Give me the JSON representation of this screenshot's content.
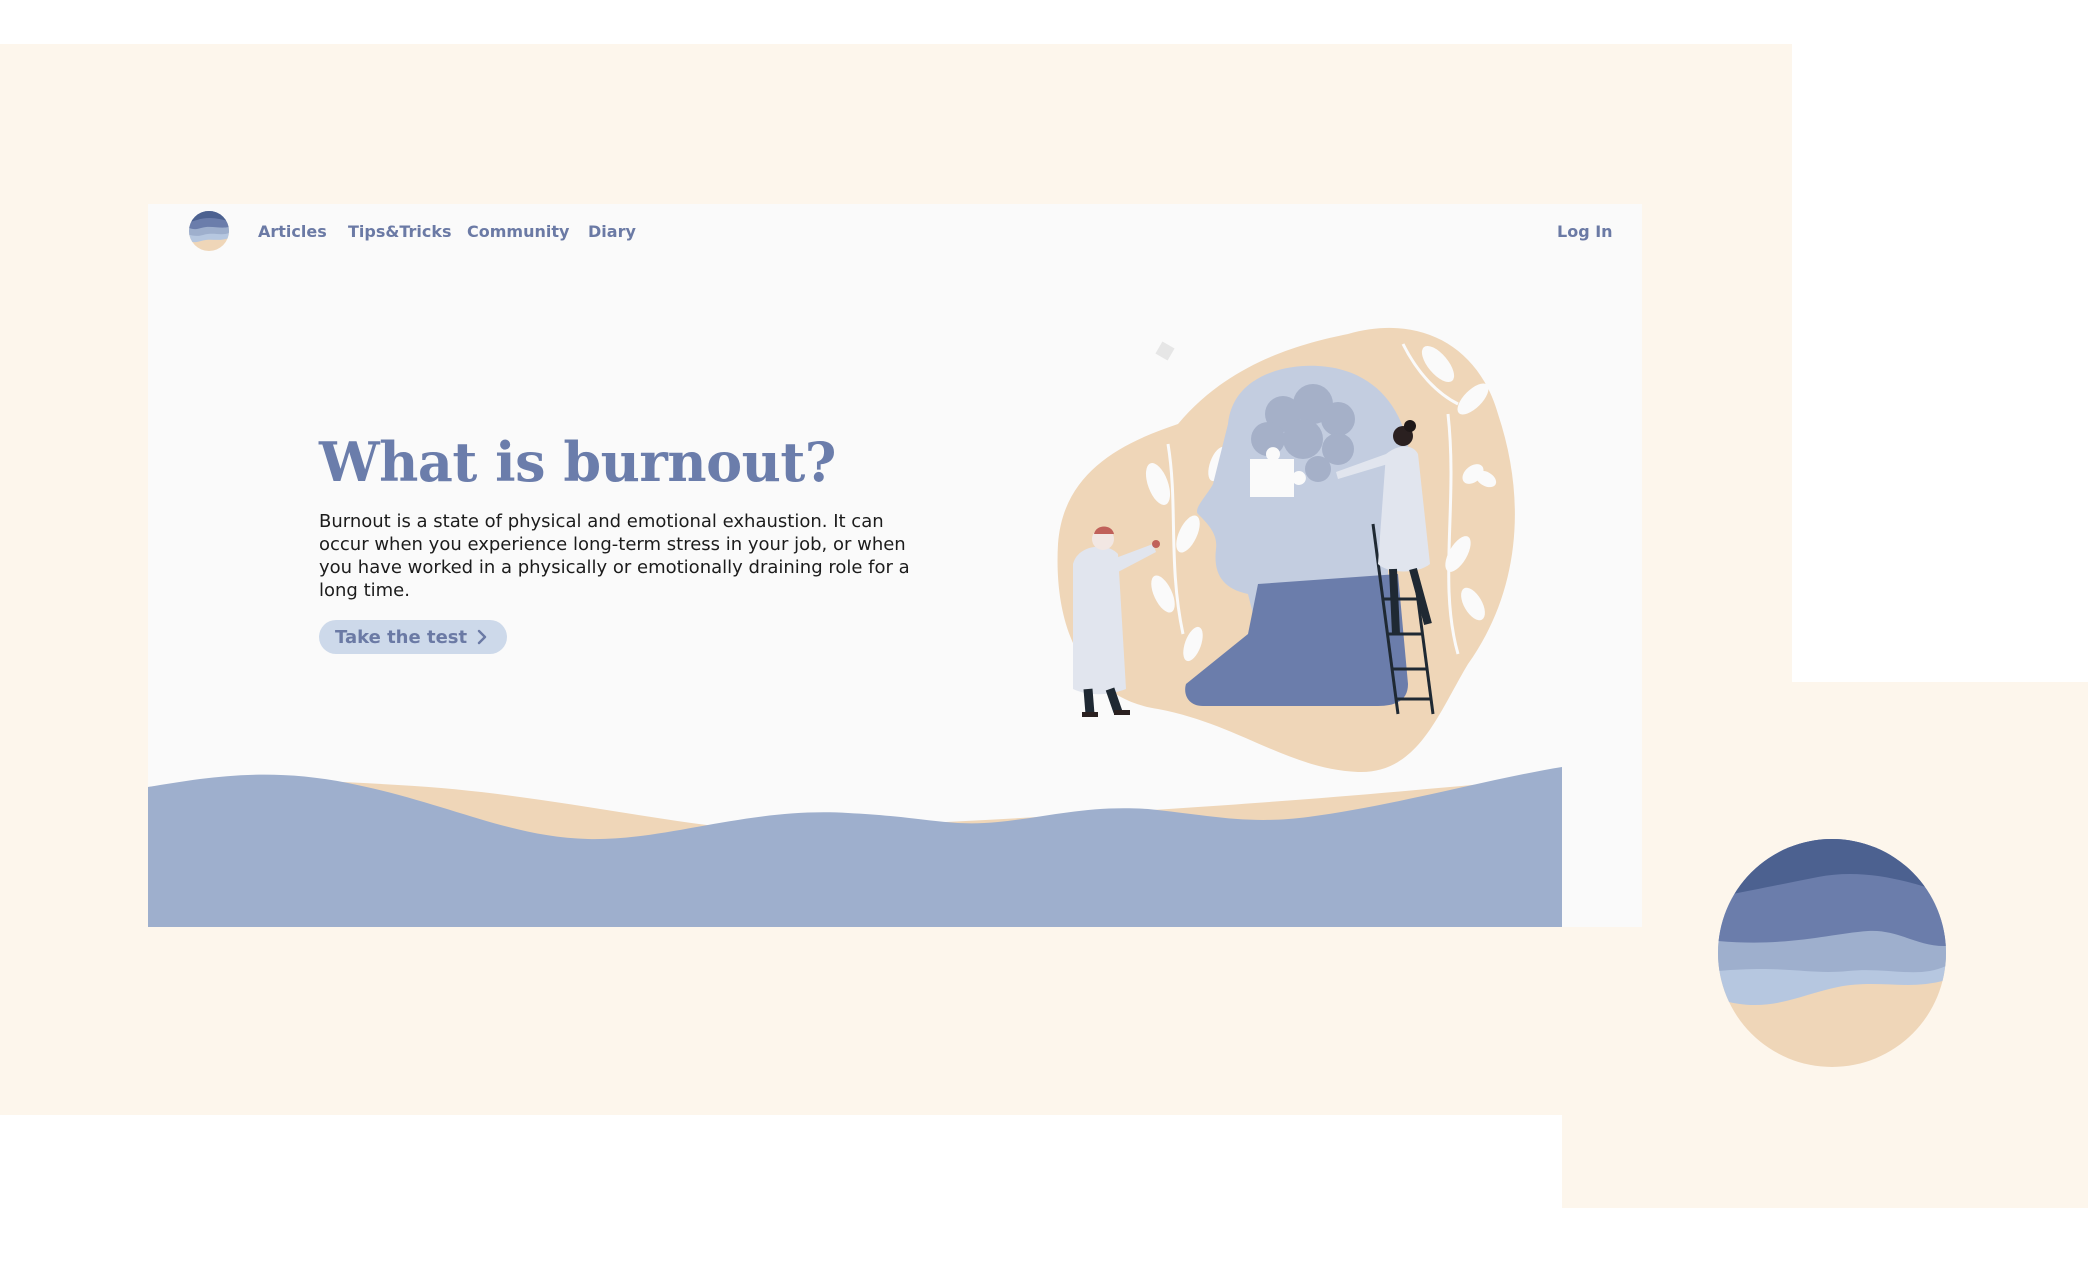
{
  "nav": {
    "links": [
      "Articles",
      "Tips&Tricks",
      "Community",
      "Diary"
    ],
    "login": "Log In"
  },
  "hero": {
    "title": "What is burnout?",
    "description": "Burnout is a state of physical and emotional exhaustion. It can occur when you experience long-term stress in your job, or when you have worked in a physically or emotionally draining role for a long time.",
    "cta_label": "Take the test"
  },
  "icons": {
    "logo": "wave-circle-logo",
    "cta": "chevron-right-icon"
  },
  "colors": {
    "page_background": "#fdf6ec",
    "hero_background": "#fafafa",
    "accent_text": "#6b7aa5",
    "wave_blue": "#9eafcd",
    "wave_sand": "#efd6b8",
    "button_bg": "#cdd9ea"
  }
}
